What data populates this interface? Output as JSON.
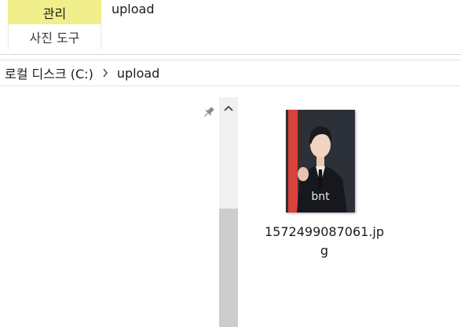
{
  "ribbon": {
    "tab_manage_label": "관리",
    "tab_photo_tools_label": "사진 도구",
    "active_tab_color": "#f0ef8c",
    "window_title": "upload"
  },
  "address_bar": {
    "crumbs": [
      "로컬 디스크 (C:)",
      "upload"
    ]
  },
  "nav_pane": {
    "pin_icon": "pin-icon",
    "scroll_up_icon": "chevron-up-icon"
  },
  "content": {
    "files": [
      {
        "name": "1572499087061.jpg",
        "thumbnail_watermark": "bnt",
        "icon": "image-thumbnail"
      }
    ]
  }
}
